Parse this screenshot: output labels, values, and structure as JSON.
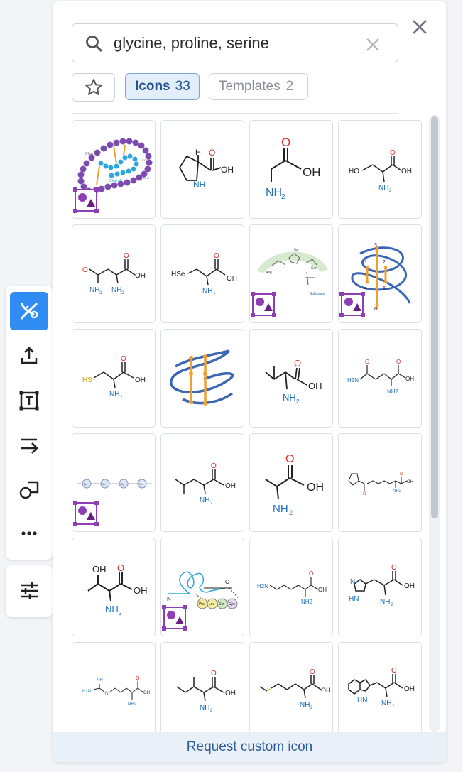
{
  "search": {
    "value": "glycine, proline, serine"
  },
  "tabs": {
    "icons_label": "Icons",
    "icons_count": "33",
    "templates_label": "Templates",
    "templates_count": "2"
  },
  "footer": {
    "request_label": "Request custom icon"
  },
  "icons": {
    "search": "search-icon",
    "clear": "close-icon",
    "close": "close-icon",
    "favorite": "star-icon"
  },
  "toolbar": {
    "tools": [
      "dna-icon",
      "upload-icon",
      "text-box-icon",
      "arrow-icon",
      "shapes-icon",
      "more-icon"
    ],
    "settings": "sliders-icon"
  },
  "colors": {
    "accent": "#2e8cf2",
    "tab_active_bg": "#e3eefb",
    "tab_active_text": "#24538d",
    "template_badge": "#8e3fb5"
  },
  "grid_items": [
    {
      "name": "protein-chain-template",
      "labels": [
        "Chain B",
        "Chain A",
        "COOH",
        "NH2"
      ]
    },
    {
      "name": "proline",
      "labels": [
        "H",
        "O",
        "OH",
        "NH"
      ]
    },
    {
      "name": "glycine",
      "labels": [
        "O",
        "OH",
        "NH2"
      ]
    },
    {
      "name": "serine",
      "labels": [
        "HO",
        "O",
        "OH",
        "NH2"
      ]
    },
    {
      "name": "asparagine",
      "labels": [
        "O",
        "O",
        "OH",
        "NH2",
        "NH2"
      ]
    },
    {
      "name": "selenocysteine",
      "labels": [
        "HSe",
        "O",
        "OH",
        "NH2"
      ]
    },
    {
      "name": "active-site-template",
      "labels": [
        "His",
        "Asp",
        "Ser",
        "Substrate"
      ]
    },
    {
      "name": "disulfide-protein-template",
      "labels": [
        "3",
        "1",
        "2",
        "4",
        "5",
        "6"
      ]
    },
    {
      "name": "cysteine",
      "labels": [
        "HS",
        "O",
        "OH",
        "NH2"
      ]
    },
    {
      "name": "disulfide-protein",
      "labels": []
    },
    {
      "name": "valine",
      "labels": [
        "O",
        "OH",
        "NH2"
      ]
    },
    {
      "name": "glutamine",
      "labels": [
        "O",
        "O",
        "H2N",
        "OH",
        "NH2"
      ]
    },
    {
      "name": "peptide-chain-template",
      "labels": [
        "Tyr",
        "Ser",
        "Gly",
        "Ser"
      ]
    },
    {
      "name": "leucine",
      "labels": [
        "O",
        "OH",
        "NH2"
      ]
    },
    {
      "name": "alanine",
      "labels": [
        "O",
        "OH",
        "NH2"
      ]
    },
    {
      "name": "pyrrolysine",
      "labels": [
        "O",
        "OH",
        "NH2"
      ]
    },
    {
      "name": "threonine",
      "labels": [
        "OH",
        "O",
        "OH",
        "NH2"
      ]
    },
    {
      "name": "peptide-sequence-template",
      "labels": [
        "C",
        "N",
        "Phe",
        "Leu",
        "Ser",
        "Cys"
      ]
    },
    {
      "name": "lysine",
      "labels": [
        "H2N",
        "O",
        "OH",
        "NH2"
      ]
    },
    {
      "name": "histidine",
      "labels": [
        "N",
        "HN",
        "O",
        "OH",
        "NH2"
      ]
    },
    {
      "name": "arginine",
      "labels": [
        "NH",
        "H2N",
        "O",
        "OH",
        "NH2"
      ]
    },
    {
      "name": "isoleucine",
      "labels": [
        "O",
        "OH",
        "NH2"
      ]
    },
    {
      "name": "methionine",
      "labels": [
        "S",
        "O",
        "OH",
        "NH2"
      ]
    },
    {
      "name": "tryptophan",
      "labels": [
        "HN",
        "O",
        "OH",
        "NH2"
      ]
    }
  ]
}
